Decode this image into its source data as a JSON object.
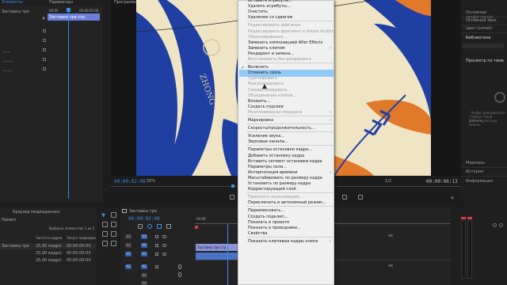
{
  "effect_controls": {
    "tab_label": "Заставка тре",
    "tab_label_right": "Параметры",
    "timecode_start": "00:00",
    "timecode_end": "00:00:05:00",
    "clip_label": "Заставка тре",
    "clip_bar_label": "Заставка тре стр"
  },
  "program_monitor": {
    "tab_label": "Программа: Заставка тре",
    "current_timecode": "00:00:02:08",
    "zoom": "50%",
    "resolution": "1/2",
    "duration_timecode": "00:00:06:13",
    "preview_text": "ZHONG"
  },
  "right_panel": {
    "items": [
      "Основные графические",
      "Основной звук",
      "Цвет Lumetri",
      "Библиотеки"
    ],
    "stock_label": "Просмотр по теме",
    "cc_text_1": "Чтобы пользоваться",
    "cc_text_2": "Creative Cloud Libraries,",
    "cc_text_3": "войти в учетную запись",
    "bottom_items": [
      "Маркеры",
      "История",
      "Информация"
    ]
  },
  "project": {
    "tab_1": "Браузер медиаданных",
    "tab_2": "Проект",
    "selected_text": "Выбрано элементов: 1 из 1",
    "col_1": "Частота кадров",
    "col_2": "Запуск медиадан",
    "rows": [
      {
        "name": "Заставка тре",
        "fps": "25,00 кадр/с",
        "start": "00:00:00:00"
      },
      {
        "name": "",
        "fps": "25,00 кадр/с",
        "start": "00:00:00:00"
      },
      {
        "name": "",
        "fps": "25,00 кадр/с",
        "start": "00:00:00:00"
      }
    ]
  },
  "timeline": {
    "tab_label": "Заставка тре",
    "timecode": "00:00:02:08",
    "ruler_start": "00:00",
    "video_tracks": [
      "V3",
      "V2",
      "V1"
    ],
    "audio_tracks": [
      "A1",
      "A2",
      "A3"
    ],
    "clip_label": "Заставка тре стр"
  },
  "context_menu": {
    "items": [
      {
        "label": "Вставить атрибуты...",
        "disabled": false
      },
      {
        "label": "Удалить атрибуты...",
        "disabled": false
      },
      {
        "label": "Очистить",
        "disabled": false
      },
      {
        "label": "Удаление со сдвигом",
        "disabled": false
      },
      {
        "sep": true
      },
      {
        "label": "Редактировать оригинал",
        "disabled": true
      },
      {
        "label": "Редактировать фрагмент в Adobe Audition",
        "disabled": true
      },
      {
        "label": "Лицензирование...",
        "disabled": true
      },
      {
        "label": "Заменить композицией After Effects",
        "disabled": false
      },
      {
        "label": "Заменить клипом",
        "disabled": false,
        "submenu": true
      },
      {
        "label": "Рендеринг и замена...",
        "disabled": false
      },
      {
        "label": "Восстановить без рендеринга",
        "disabled": true
      },
      {
        "sep": true
      },
      {
        "label": "Включить",
        "disabled": false,
        "checked": true
      },
      {
        "label": "Отменить связь",
        "disabled": false,
        "highlighted": true
      },
      {
        "label": "Группировать",
        "disabled": true
      },
      {
        "label": "Разгруппировать",
        "disabled": true
      },
      {
        "label": "Синхронизировать",
        "disabled": true
      },
      {
        "label": "Объединение клипов...",
        "disabled": true
      },
      {
        "label": "Вложить...",
        "disabled": false
      },
      {
        "label": "Создать подсекв",
        "disabled": false
      },
      {
        "label": "Многокамерная передача",
        "disabled": true,
        "submenu": true
      },
      {
        "sep": true
      },
      {
        "label": "Маркировка",
        "disabled": false,
        "submenu": true
      },
      {
        "sep": true
      },
      {
        "label": "Скорость/продолжительность...",
        "disabled": false
      },
      {
        "sep": true
      },
      {
        "label": "Усиление звука...",
        "disabled": false
      },
      {
        "label": "Звуковые каналы...",
        "disabled": false
      },
      {
        "sep": true
      },
      {
        "label": "Параметры остановки кадра...",
        "disabled": false
      },
      {
        "label": "Добавить остановку кадра",
        "disabled": false
      },
      {
        "label": "Вставить сегмент остановки кадра",
        "disabled": false
      },
      {
        "label": "Параметры поля...",
        "disabled": false
      },
      {
        "label": "Интерполяция времени",
        "disabled": false,
        "submenu": true
      },
      {
        "label": "Масштабировать по размеру кадра",
        "disabled": false
      },
      {
        "label": "Установить по размеру кадра",
        "disabled": false
      },
      {
        "label": "Корректирующий слой",
        "disabled": false
      },
      {
        "sep": true
      },
      {
        "label": "Привязать мультимедиа...",
        "disabled": true
      },
      {
        "label": "Переключить в автономный режим...",
        "disabled": false
      },
      {
        "sep": true
      },
      {
        "label": "Переименовать...",
        "disabled": false
      },
      {
        "label": "Создать подклип...",
        "disabled": false
      },
      {
        "label": "Показать в проекте",
        "disabled": false
      },
      {
        "label": "Показать в проводнике...",
        "disabled": false
      },
      {
        "label": "Свойства",
        "disabled": false
      },
      {
        "sep": true
      },
      {
        "label": "Показать ключевые кадры клипа",
        "disabled": false,
        "submenu": true
      }
    ]
  },
  "colors": {
    "accent": "#3a8ee6",
    "highlight": "#91c9f7",
    "clip_video": "#8c93d9",
    "clip_audio": "#4a72c6",
    "artwork_navy": "#1f3fa3",
    "artwork_orange": "#e07a2a",
    "artwork_bg": "#efe4c4"
  }
}
